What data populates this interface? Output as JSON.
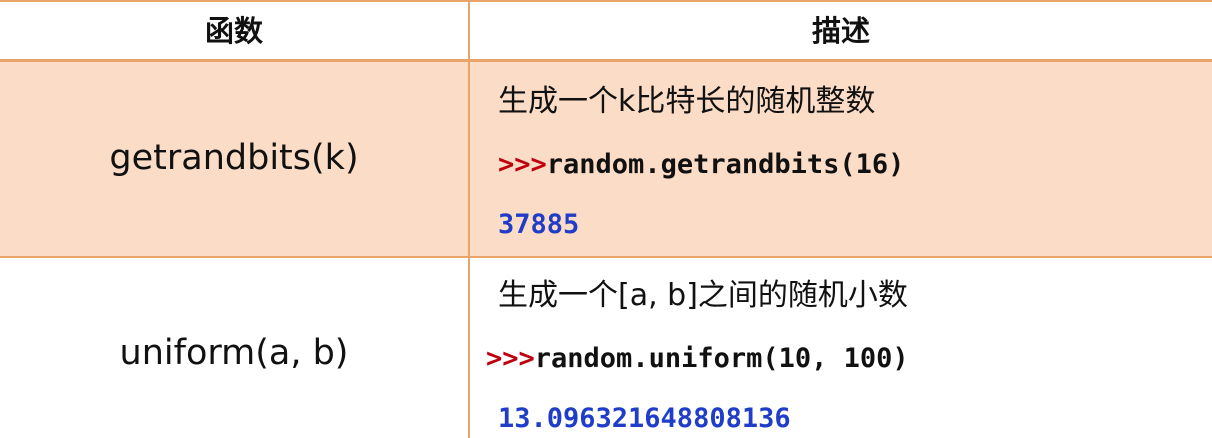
{
  "table": {
    "headers": [
      "函数",
      "描述"
    ],
    "rows": [
      {
        "function": "getrandbits(k)",
        "description": "生成一个k比特长的随机整数",
        "prompt": ">>>",
        "code": "random.getrandbits(16)",
        "result": "37885"
      },
      {
        "function": "uniform(a, b)",
        "description": "生成一个[a, b]之间的随机小数",
        "prompt": ">>>",
        "code": "random.uniform(10, 100)",
        "result": "13.096321648808136"
      }
    ]
  },
  "colors": {
    "border": "#e9a46a",
    "highlight_row": "#fbdcc6",
    "prompt": "#c0000e",
    "result": "#1f3dc8"
  }
}
